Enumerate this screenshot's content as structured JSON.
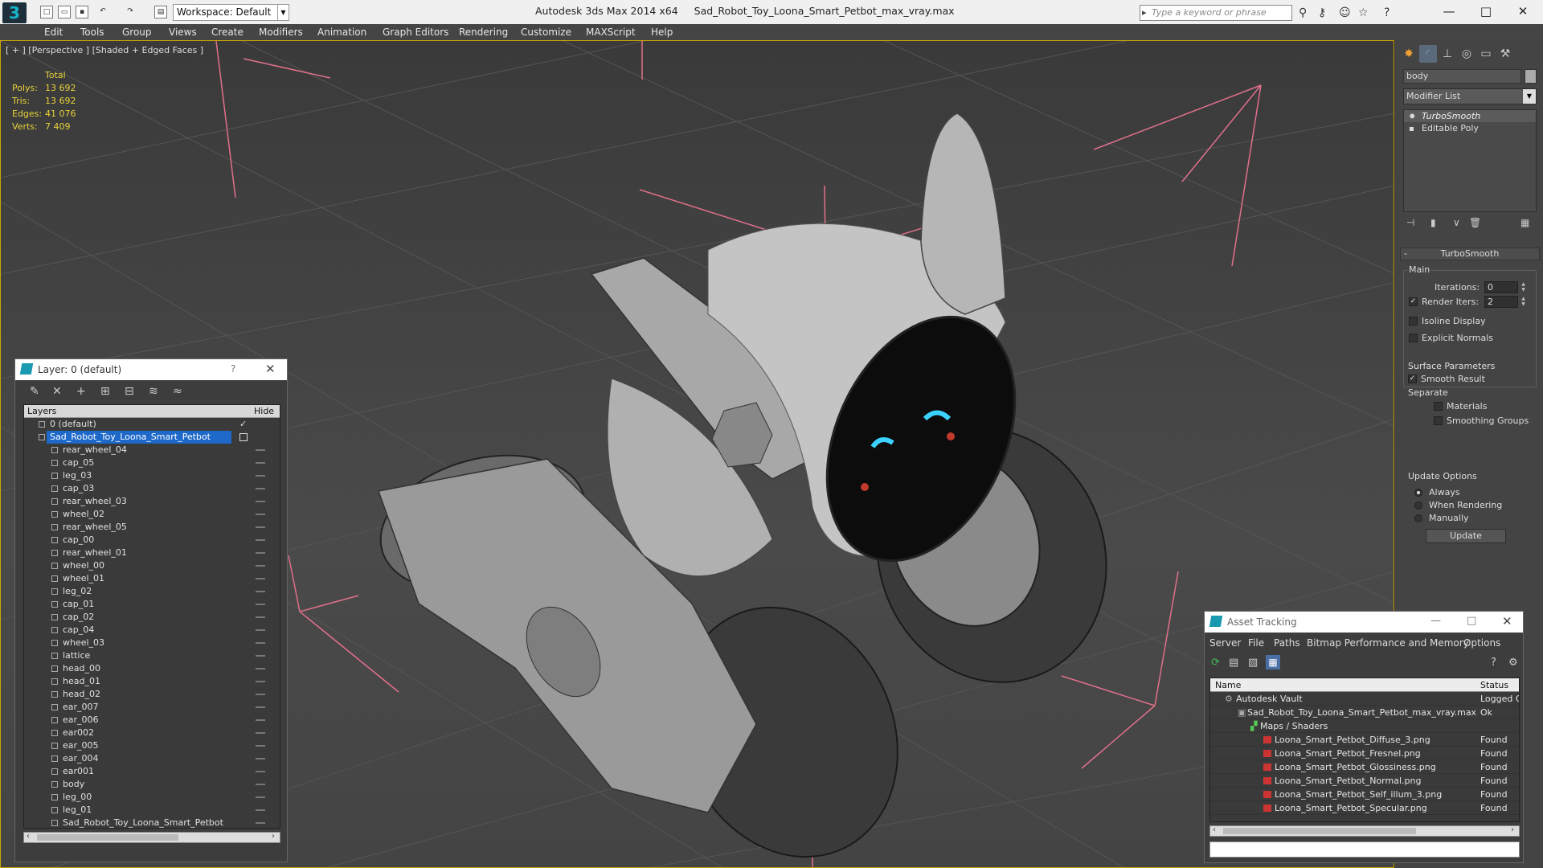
{
  "titlebar": {
    "app": "Autodesk 3ds Max  2014 x64",
    "file": "Sad_Robot_Toy_Loona_Smart_Petbot_max_vray.max",
    "workspace": "Workspace: Default",
    "search_placeholder": "Type a keyword or phrase"
  },
  "menu": [
    "Edit",
    "Tools",
    "Group",
    "Views",
    "Create",
    "Modifiers",
    "Animation",
    "Graph Editors",
    "Rendering",
    "Customize",
    "MAXScript",
    "Help"
  ],
  "viewport": {
    "label": "[ + ] [Perspective ] [Shaded + Edged Faces ]",
    "stats": {
      "header": "Total",
      "polys_label": "Polys:",
      "polys": "13 692",
      "tris_label": "Tris:",
      "tris": "13 692",
      "edges_label": "Edges:",
      "edges": "41 076",
      "verts_label": "Verts:",
      "verts": "7 409"
    }
  },
  "command_panel": {
    "object_name": "body",
    "modifier_list": "Modifier List",
    "stack": [
      "TurboSmooth",
      "Editable Poly"
    ],
    "rollout_title": "TurboSmooth",
    "main_group": "Main",
    "iterations_label": "Iterations:",
    "iterations": "0",
    "render_iters_label": "Render Iters:",
    "render_iters": "2",
    "isoline": "Isoline Display",
    "explicit_normals": "Explicit Normals",
    "surface_group": "Surface Parameters",
    "smooth_result": "Smooth Result",
    "separate": "Separate",
    "materials": "Materials",
    "smoothing_groups": "Smoothing Groups",
    "update_group": "Update Options",
    "always": "Always",
    "when_rendering": "When Rendering",
    "manually": "Manually",
    "update_btn": "Update"
  },
  "layer_dialog": {
    "title": "Layer: 0 (default)",
    "col_layers": "Layers",
    "col_hide": "Hide",
    "rows": [
      "0 (default)",
      "Sad_Robot_Toy_Loona_Smart_Petbot",
      "rear_wheel_04",
      "cap_05",
      "leg_03",
      "cap_03",
      "rear_wheel_03",
      "wheel_02",
      "rear_wheel_05",
      "cap_00",
      "rear_wheel_01",
      "wheel_00",
      "wheel_01",
      "leg_02",
      "cap_01",
      "cap_02",
      "cap_04",
      "wheel_03",
      "lattice",
      "head_00",
      "head_01",
      "head_02",
      "ear_007",
      "ear_006",
      "ear002",
      "ear_005",
      "ear_004",
      "ear001",
      "body",
      "leg_00",
      "leg_01",
      "Sad_Robot_Toy_Loona_Smart_Petbot"
    ]
  },
  "asset_dialog": {
    "title": "Asset Tracking",
    "menu": [
      "Server",
      "File",
      "Paths",
      "Bitmap Performance and Memory",
      "Options"
    ],
    "col_name": "Name",
    "col_status": "Status",
    "rows": [
      {
        "name": "Autodesk Vault",
        "status": "Logged Ou"
      },
      {
        "name": "Sad_Robot_Toy_Loona_Smart_Petbot_max_vray.max",
        "status": "Ok"
      },
      {
        "name": "Maps / Shaders",
        "status": ""
      },
      {
        "name": "Loona_Smart_Petbot_Diffuse_3.png",
        "status": "Found"
      },
      {
        "name": "Loona_Smart_Petbot_Fresnel.png",
        "status": "Found"
      },
      {
        "name": "Loona_Smart_Petbot_Glossiness.png",
        "status": "Found"
      },
      {
        "name": "Loona_Smart_Petbot_Normal.png",
        "status": "Found"
      },
      {
        "name": "Loona_Smart_Petbot_Self_illum_3.png",
        "status": "Found"
      },
      {
        "name": "Loona_Smart_Petbot_Specular.png",
        "status": "Found"
      }
    ]
  }
}
